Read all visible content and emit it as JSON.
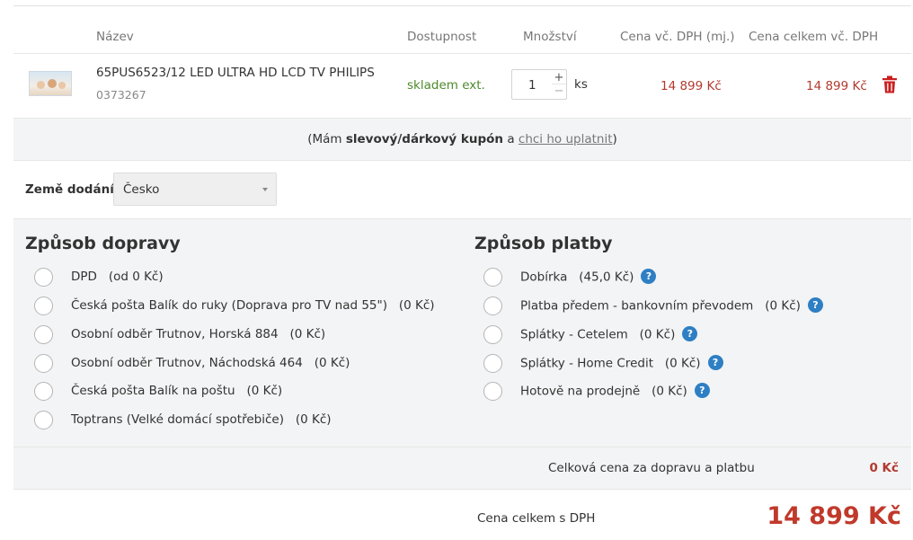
{
  "table": {
    "headers": {
      "name": "Název",
      "availability": "Dostupnost",
      "quantity": "Množství",
      "unit_price": "Cena vč. DPH (mj.)",
      "total_price": "Cena celkem vč. DPH"
    }
  },
  "product": {
    "name": "65PUS6523/12 LED ULTRA HD LCD TV PHILIPS",
    "code": "0373267",
    "availability": "skladem ext.",
    "quantity": "1",
    "quantity_plus": "+",
    "quantity_minus": "−",
    "unit": "ks",
    "unit_price": "14 899 Kč",
    "total_price": "14 899 Kč"
  },
  "coupon": {
    "open_paren": "(Mám ",
    "bold": "slevový/dárkový kupón",
    "mid": " a ",
    "link": "chci ho uplatnit",
    "close_paren": ")"
  },
  "country": {
    "label": "Země dodání",
    "selected": "Česko"
  },
  "shipping": {
    "title": "Způsob dopravy",
    "options": [
      {
        "label": "DPD",
        "price": "(od 0 Kč)"
      },
      {
        "label": "Česká pošta Balík do ruky (Doprava pro TV nad 55\")",
        "price": "(0 Kč)"
      },
      {
        "label": "Osobní odběr Trutnov, Horská 884",
        "price": "(0 Kč)"
      },
      {
        "label": "Osobní odběr Trutnov, Náchodská 464",
        "price": "(0 Kč)"
      },
      {
        "label": "Česká pošta Balík na poštu",
        "price": "(0 Kč)"
      },
      {
        "label": "Toptrans (Velké domácí spotřebiče)",
        "price": "(0 Kč)"
      }
    ]
  },
  "payment": {
    "title": "Způsob platby",
    "help_glyph": "?",
    "options": [
      {
        "label": "Dobírka",
        "price": "(45,0 Kč)"
      },
      {
        "label": "Platba předem - bankovním převodem",
        "price": "(0 Kč)"
      },
      {
        "label": "Splátky - Cetelem",
        "price": "(0 Kč)"
      },
      {
        "label": "Splátky - Home Credit",
        "price": "(0 Kč)"
      },
      {
        "label": "Hotově na prodejně",
        "price": "(0 Kč)"
      }
    ]
  },
  "summary": {
    "shipping_payment_label": "Celková cena za dopravu a platbu",
    "shipping_payment_value": "0 Kč",
    "total_label": "Cena celkem s DPH",
    "total_value": "14 899 Kč"
  },
  "colors": {
    "price_red": "#b23a30",
    "total_red": "#c0392b",
    "stock_green": "#4c8a2b",
    "help_blue": "#2e7fc4"
  },
  "icons": {
    "delete": "trash-icon",
    "help": "help-icon",
    "dropdown": "chevron-down-icon"
  }
}
